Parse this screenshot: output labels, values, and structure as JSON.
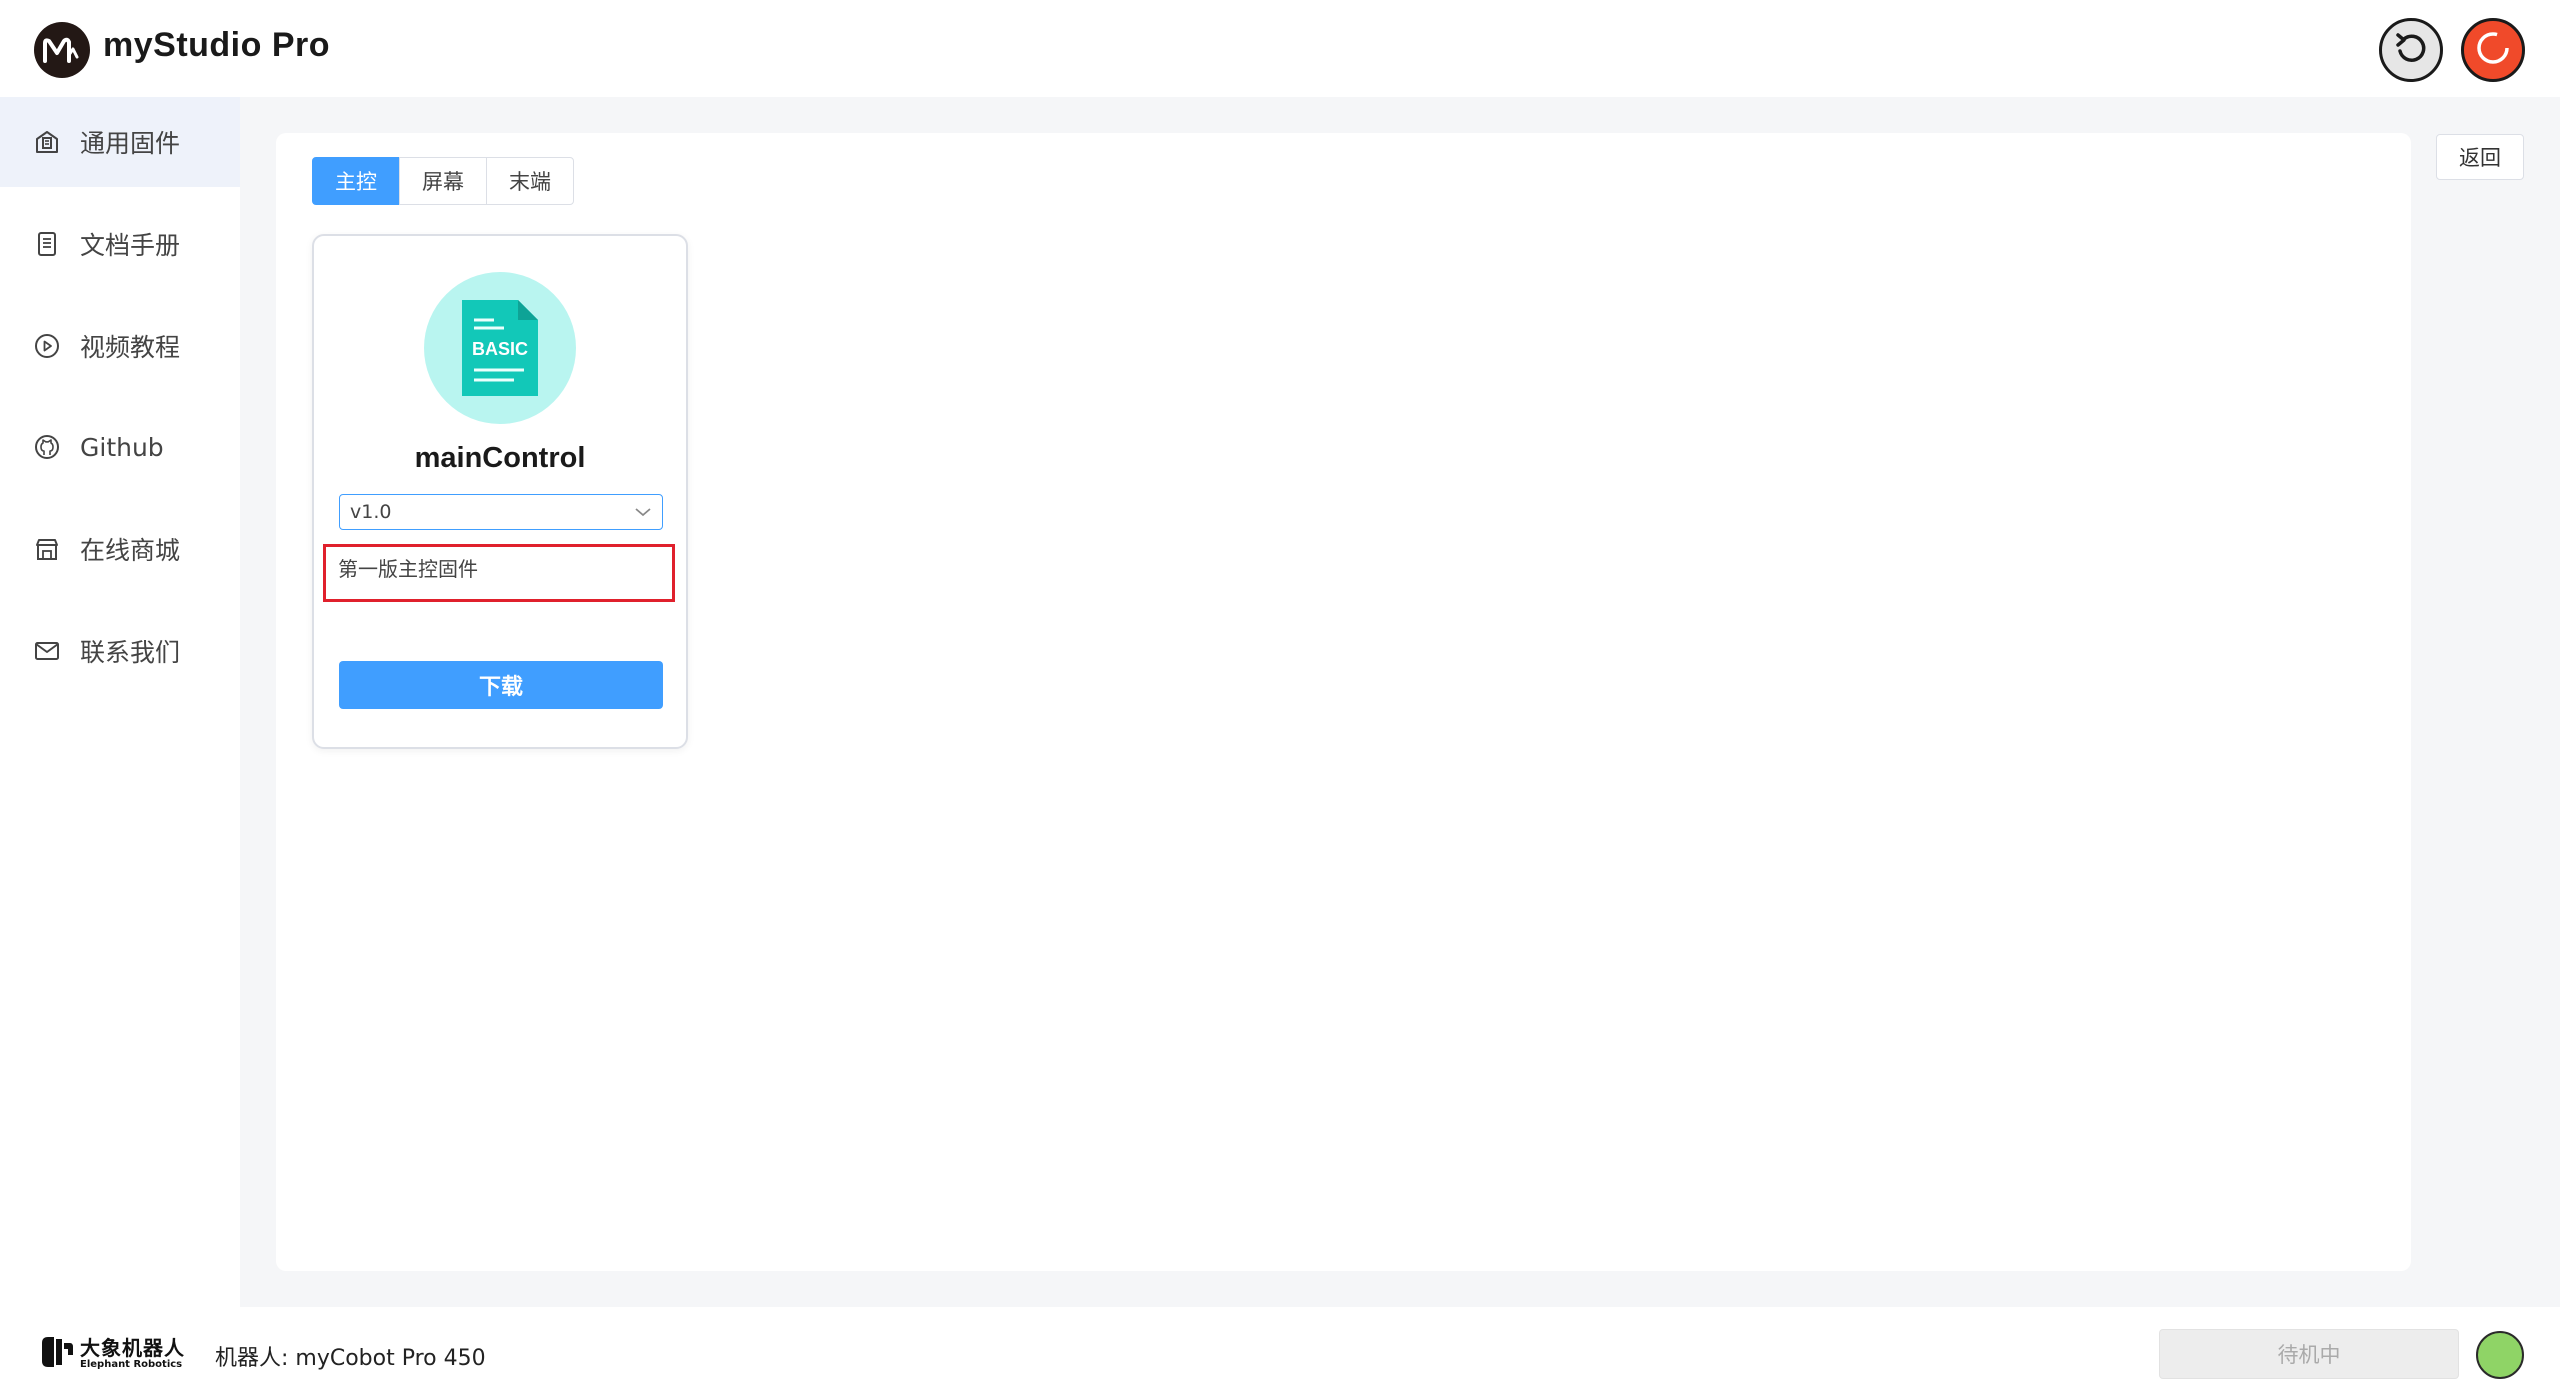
{
  "app": {
    "title": "myStudio Pro",
    "logo_icon": "mystudio-logo-icon"
  },
  "header": {
    "undo_icon": "undo-icon",
    "power_icon": "power-icon"
  },
  "sidebar": {
    "items": [
      {
        "label": "通用固件",
        "icon": "firmware-icon",
        "active": true
      },
      {
        "label": "文档手册",
        "icon": "document-icon",
        "active": false
      },
      {
        "label": "视频教程",
        "icon": "play-icon",
        "active": false
      },
      {
        "label": "Github",
        "icon": "github-icon",
        "active": false
      },
      {
        "label": "在线商城",
        "icon": "store-icon",
        "active": false
      },
      {
        "label": "联系我们",
        "icon": "mail-icon",
        "active": false
      }
    ]
  },
  "main": {
    "back_label": "返回",
    "tabs": [
      {
        "label": "主控",
        "active": true
      },
      {
        "label": "屏幕",
        "active": false
      },
      {
        "label": "末端",
        "active": false
      }
    ],
    "card": {
      "icon": "basic-file-icon",
      "icon_text": "BASIC",
      "title": "mainControl",
      "version": "v1.0",
      "description": "第一版主控固件",
      "download_label": "下载"
    }
  },
  "footer": {
    "brand_cn": "大象机器人",
    "brand_en": "Elephant Robotics",
    "robot_label": "机器人: myCobot Pro 450",
    "status_text": "待机中",
    "status_color": "#8fd466"
  },
  "colors": {
    "accent": "#409eff",
    "highlight_border": "#e0202c",
    "icon_bg": "#b9f5f0",
    "icon_fg": "#12c8b8"
  }
}
